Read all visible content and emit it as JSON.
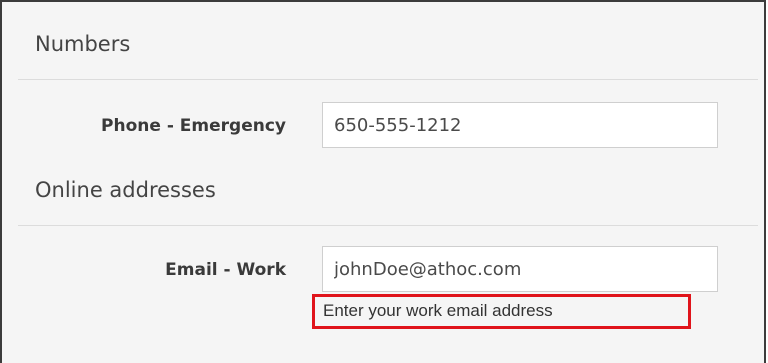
{
  "sections": {
    "numbers": {
      "title": "Numbers",
      "field_label": "Phone - Emergency",
      "field_value": "650-555-1212"
    },
    "online": {
      "title": "Online addresses",
      "field_label": "Email - Work",
      "field_value": "johnDoe@athoc.com",
      "helper_text": "Enter your work email address"
    }
  },
  "colors": {
    "highlight": "#e0141b",
    "panel_background": "#f5f5f5"
  }
}
